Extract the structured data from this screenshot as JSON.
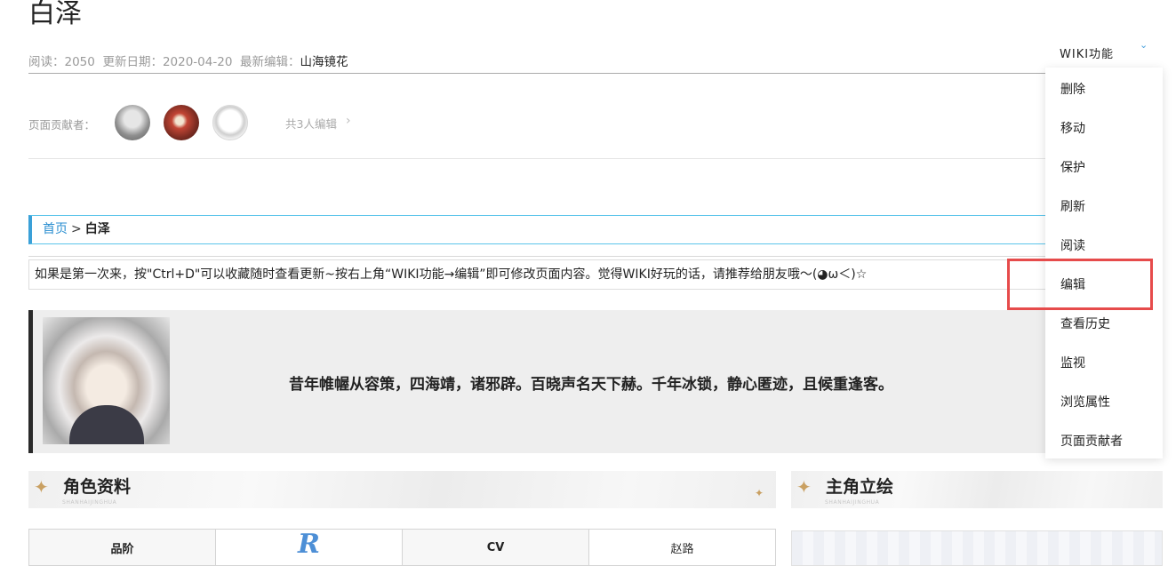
{
  "page": {
    "title": "白泽",
    "meta": {
      "reads_label": "阅读：",
      "reads": "2050",
      "updated_label": "更新日期：",
      "updated": "2020-04-20",
      "editor_label": "最新编辑：",
      "editor": "山海镜花"
    },
    "contributors": {
      "label": "页面贡献者：",
      "total": "共3人编辑",
      "chevron": "›"
    },
    "breadcrumb": {
      "home": "首页",
      "separator": ">",
      "current": "白泽"
    },
    "notice": "如果是第一次来，按\"Ctrl+D\"可以收藏随时查看更新~按右上角“WIKI功能→编辑”即可修改页面内容。觉得WIKI好玩的话，请推荐给朋友哦～(◕ω＜)☆",
    "quote": "昔年帷幄从容策，四海靖，诸邪辟。百晓声名天下赫。千年冰锁，静心匿迹，且候重逢客。",
    "sections": {
      "profile": {
        "title": "角色资料",
        "subtitle": "SHANHAIJINGHUA"
      },
      "art": {
        "title": "主角立绘",
        "subtitle": "SHANHAIJINGHUA"
      }
    },
    "table": {
      "rank_label": "品阶",
      "rank_value": "R",
      "cv_label": "CV",
      "cv_value": "赵路"
    }
  },
  "wiki_menu": {
    "button": "WIKI功能",
    "chevron": "⌄",
    "items": [
      "删除",
      "移动",
      "保护",
      "刷新",
      "阅读",
      "编辑",
      "查看历史",
      "监视",
      "浏览属性",
      "页面贡献者"
    ],
    "highlighted_item": "编辑"
  },
  "colors": {
    "link": "#2a8ed0",
    "breadcrumb_border": "#5bc4ea",
    "highlight": "#e64b4b",
    "accent_gold": "#c9a062"
  }
}
